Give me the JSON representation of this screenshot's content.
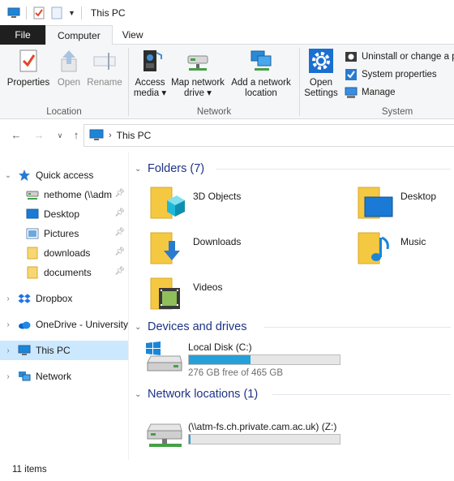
{
  "window": {
    "title": "This PC"
  },
  "tabs": {
    "file": "File",
    "computer": "Computer",
    "view": "View"
  },
  "ribbon": {
    "location": {
      "label": "Location",
      "properties": "Properties",
      "open": "Open",
      "rename": "Rename"
    },
    "network": {
      "label": "Network",
      "access_media": "Access media",
      "access_media_2": "media",
      "map_drive_1": "Map network",
      "map_drive_2": "drive",
      "add_location_1": "Add a network",
      "add_location_2": "location"
    },
    "system": {
      "label": "System",
      "open_settings_1": "Open",
      "open_settings_2": "Settings",
      "uninstall": "Uninstall or change a p",
      "system_properties": "System properties",
      "manage": "Manage"
    }
  },
  "address": {
    "crumb": "This PC"
  },
  "nav": {
    "quick_access": "Quick access",
    "nethome": "nethome (\\\\adm",
    "desktop": "Desktop",
    "pictures": "Pictures",
    "downloads": "downloads",
    "documents": "documents",
    "dropbox": "Dropbox",
    "onedrive": "OneDrive - University",
    "this_pc": "This PC",
    "network": "Network"
  },
  "content": {
    "folders_header": "Folders (7)",
    "folders": [
      "3D Objects",
      "Desktop",
      "Downloads",
      "Music",
      "Videos"
    ],
    "devices_header": "Devices and drives",
    "local_disk": {
      "name": "Local Disk (C:)",
      "free": "276 GB free of 465 GB",
      "used_fraction": 0.41
    },
    "network_header": "Network locations (1)",
    "network_drive": {
      "name": "(\\\\atm-fs.ch.private.cam.ac.uk) (Z:)",
      "used_fraction": 0.01
    }
  },
  "status": {
    "items": "11 items"
  },
  "colors": {
    "accent": "#26a0da",
    "header_blue": "#1e3287",
    "selected": "#cce8ff",
    "folder_yellow": "#f5c842"
  }
}
